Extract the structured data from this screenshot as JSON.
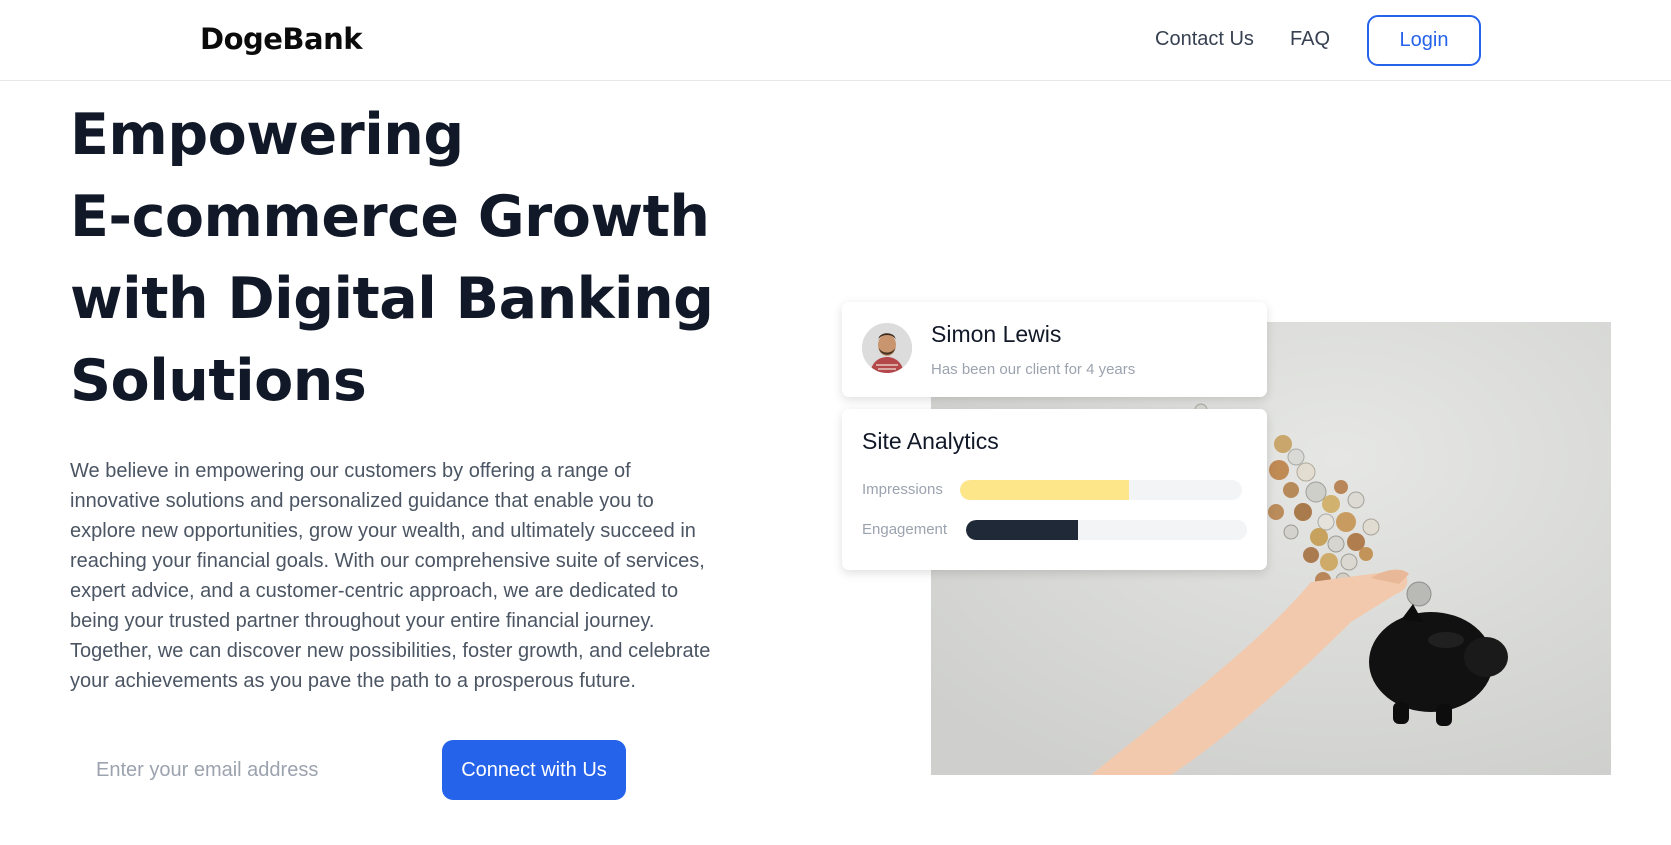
{
  "brand": {
    "name": "DogeBank"
  },
  "nav": {
    "links": [
      {
        "label": "Contact Us"
      },
      {
        "label": "FAQ"
      }
    ],
    "login_label": "Login"
  },
  "hero": {
    "title_lines": [
      "Empowering",
      "E-commerce Growth",
      "with Digital Banking",
      "Solutions"
    ],
    "description": "We believe in empowering our customers by offering a range of innovative solutions and personalized guidance that enable you to explore new opportunities, grow your wealth, and ultimately succeed in reaching your financial goals. With our comprehensive suite of services, expert advice, and a customer-centric approach, we are dedicated to being your trusted partner throughout your entire financial journey. Together, we can discover new possibilities, foster growth, and celebrate your achievements as you pave the path to a prosperous future.",
    "email_placeholder": "Enter your email address",
    "cta_label": "Connect with Us"
  },
  "client_card": {
    "name": "Simon Lewis",
    "subtitle": "Has been our client for 4 years"
  },
  "analytics": {
    "title": "Site Analytics",
    "metrics": [
      {
        "label": "Impressions",
        "value": 0.6,
        "color": "#fde68a"
      },
      {
        "label": "Engagement",
        "value": 0.4,
        "color": "#1f2937"
      }
    ]
  },
  "colors": {
    "accent": "#2563eb",
    "heading": "#111827",
    "body_text": "#4b5563"
  }
}
